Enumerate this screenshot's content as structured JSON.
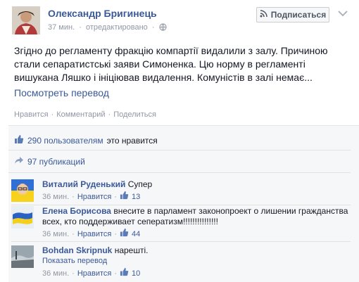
{
  "post": {
    "author": "Олександр Бригинець",
    "time": "37 мин.",
    "edited": "отредактировано",
    "subscribe_label": "Подписаться",
    "text": "Згідно до регламенту фракцію компартії видалили з залу. Причиною стали сепаратистські заяви Симоненка. Цю норму в регламенті вишукана Ляшко і ініціював видалення. Комуністів в залі немає...",
    "see_translation": "Посмотреть перевод",
    "actions": {
      "like": "Нравится",
      "comment": "Комментарий",
      "share": "Поделиться"
    }
  },
  "feedback": {
    "likes_count": "290 пользователям",
    "likes_suffix": "это нравится",
    "shares": "97 публикаций"
  },
  "comments": [
    {
      "name": "Виталий Руденький",
      "text": "Супер",
      "time": "36 мин.",
      "like_label": "Нравится",
      "like_count": "13"
    },
    {
      "name": "Елена Борисова",
      "text": "внесите в парламент законопроект о лишении гражданства всех, кто поддерживает сеператизм!!!!!!!!!!!!!!!",
      "time": "36 мин.",
      "like_label": "Нравится",
      "like_count": "44"
    },
    {
      "name": "Bohdan Skripnuk",
      "text": "нарешті.",
      "translate": "Показать перевод",
      "time": "36 мин.",
      "like_label": "Нравится",
      "like_count": "10"
    }
  ],
  "colors": {
    "link": "#3b5998",
    "meta": "#9197a3",
    "feedback_bg": "#f6f7f8"
  },
  "icons": [
    "globe-icon",
    "rss-icon",
    "chevron-down-icon",
    "thumbs-up-icon",
    "share-icon"
  ]
}
